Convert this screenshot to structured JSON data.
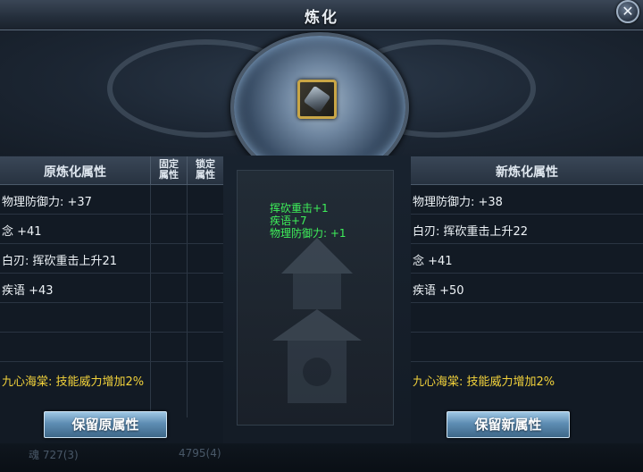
{
  "window": {
    "title": "炼化",
    "close_icon": "close-icon"
  },
  "left_panel": {
    "header": "原炼化属性",
    "col_fixed": [
      "固定",
      "属性"
    ],
    "col_locked": [
      "锁定",
      "属性"
    ],
    "attributes": [
      "物理防御力: +37",
      "念 +41",
      "白刃: 挥砍重击上升21",
      "疾语 +43",
      "",
      ""
    ],
    "bonus": "九心海棠: 技能威力增加2%",
    "button": "保留原属性"
  },
  "center_panel": {
    "changes": [
      "挥砍重击+1",
      "疾语+7",
      "物理防御力: +1"
    ]
  },
  "right_panel": {
    "header": "新炼化属性",
    "attributes": [
      "物理防御力: +38",
      "白刃: 挥砍重击上升22",
      "念 +41",
      "疾语 +50",
      "",
      ""
    ],
    "bonus": "九心海棠: 技能威力增加2%",
    "button": "保留新属性"
  },
  "footer": {
    "left_text": "魂 727(3)",
    "right_text": "4795(4)"
  },
  "colors": {
    "green": "#3ef05a",
    "gold": "#f2d23b",
    "accent": "#5e8db3"
  }
}
